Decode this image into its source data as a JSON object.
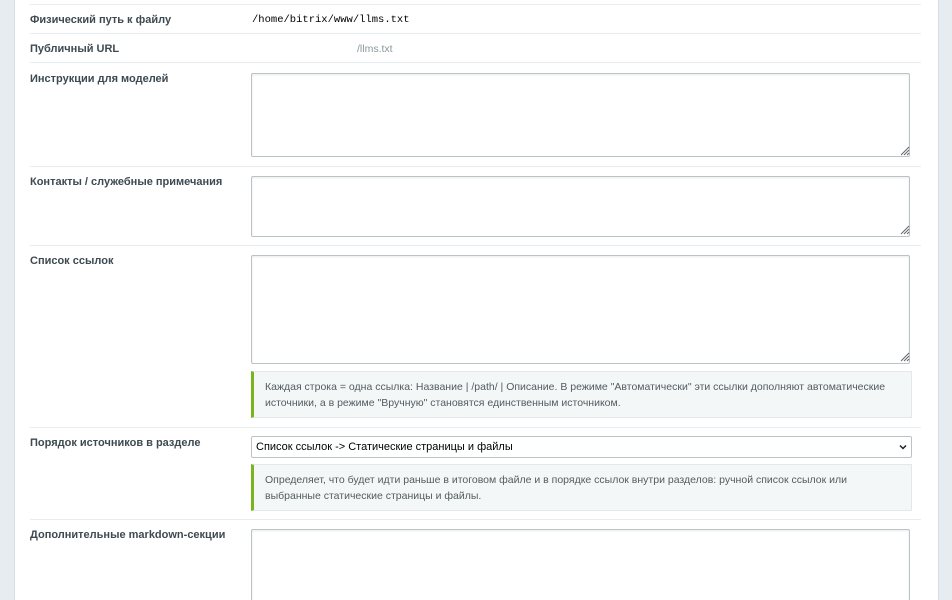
{
  "fields": {
    "physical_path": {
      "label": "Физический путь к файлу",
      "value": "/home/bitrix/www/llms.txt"
    },
    "public_url": {
      "label": "Публичный URL",
      "value": "/llms.txt"
    },
    "instructions": {
      "label": "Инструкции для моделей",
      "value": ""
    },
    "contacts": {
      "label": "Контакты / служебные примечания",
      "value": ""
    },
    "links_list": {
      "label": "Список ссылок",
      "value": "",
      "hint": "Каждая строка = одна ссылка: Название | /path/ | Описание. В режиме \"Автоматически\" эти ссылки дополняют автоматические источники, а в режиме \"Вручную\" становятся единственным источником."
    },
    "sources_order": {
      "label": "Порядок источников в разделе",
      "selected": "Список ссылок -> Статические страницы и файлы",
      "hint": "Определяет, что будет идти раньше в итоговом файле и в порядке ссылок внутри разделов: ручной список ссылок или выбранные статические страницы и файлы."
    },
    "extra_markdown": {
      "label": "Дополнительные markdown-секции",
      "value": ""
    }
  },
  "icons": {
    "resize": "resize-grip-icon",
    "dropdown": "chevron-down-icon"
  },
  "colors": {
    "accent": "#7ab51d",
    "page_bg": "#e6ecef",
    "panel_bg": "#ffffff"
  }
}
